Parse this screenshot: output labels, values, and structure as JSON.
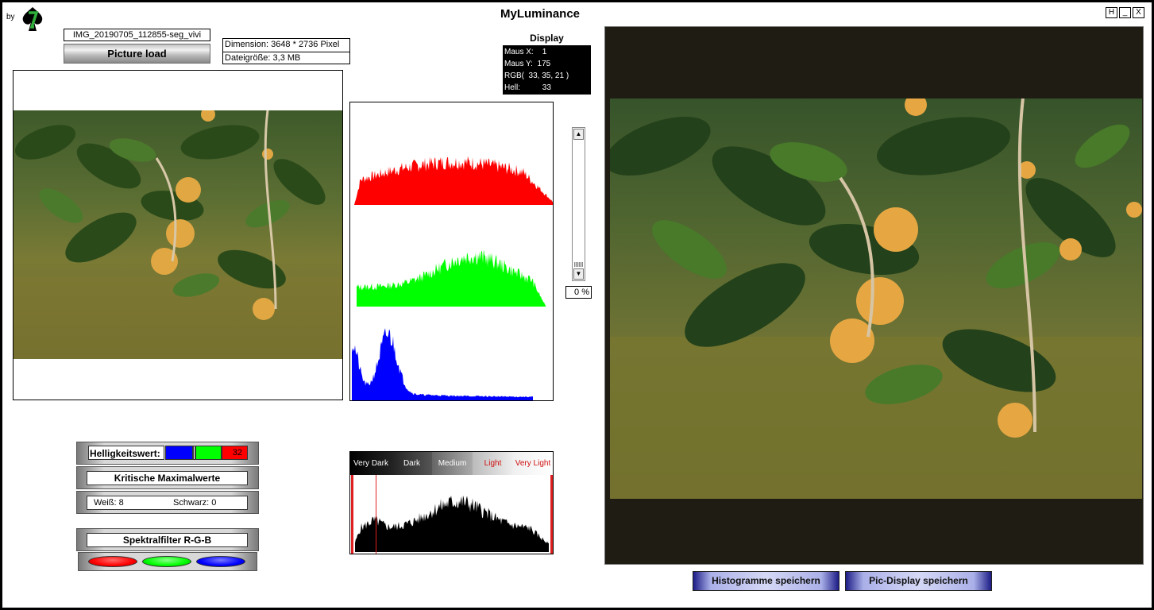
{
  "app": {
    "by_label": "by",
    "title": "MyLuminance",
    "window_buttons": [
      "H",
      "_",
      "X"
    ]
  },
  "file": {
    "name": "IMG_20190705_112855-seg_vivi",
    "load_button": "Picture load",
    "dimension": "Dimension: 3648 * 2736 Pixel",
    "filesize": "Dateigröße: 3,3 MB"
  },
  "display": {
    "label": "Display",
    "maus_x": "Maus X:    1",
    "maus_y": "Maus Y:  175",
    "rgb": "RGB(  33, 35, 21 )",
    "hell": "Hell:          33"
  },
  "histogram_panel": {
    "channels": [
      "red",
      "green",
      "blue"
    ],
    "colors": {
      "red": "#ff0000",
      "green": "#00ff00",
      "blue": "#0000ff"
    }
  },
  "scroll": {
    "percent": "0 %"
  },
  "controls": {
    "helligkeitswert_label": "Helligkeitswert:",
    "helligkeitswert_value": "32",
    "kritische_label": "Kritische Maximalwerte",
    "weiss": "Weiß:  8",
    "schwarz": "Schwarz: 0",
    "spektralfilter_label": "Spektralfilter R-G-B",
    "filter_colors": [
      "#ff0000",
      "#00ff00",
      "#0000ff"
    ]
  },
  "luminance_zones": {
    "labels": [
      "Very Dark",
      "Dark",
      "Medium",
      "Light",
      "Very Light"
    ]
  },
  "buttons": {
    "save_histograms": "Histogramme speichern",
    "save_picdisplay": "Pic-Display speichern"
  }
}
